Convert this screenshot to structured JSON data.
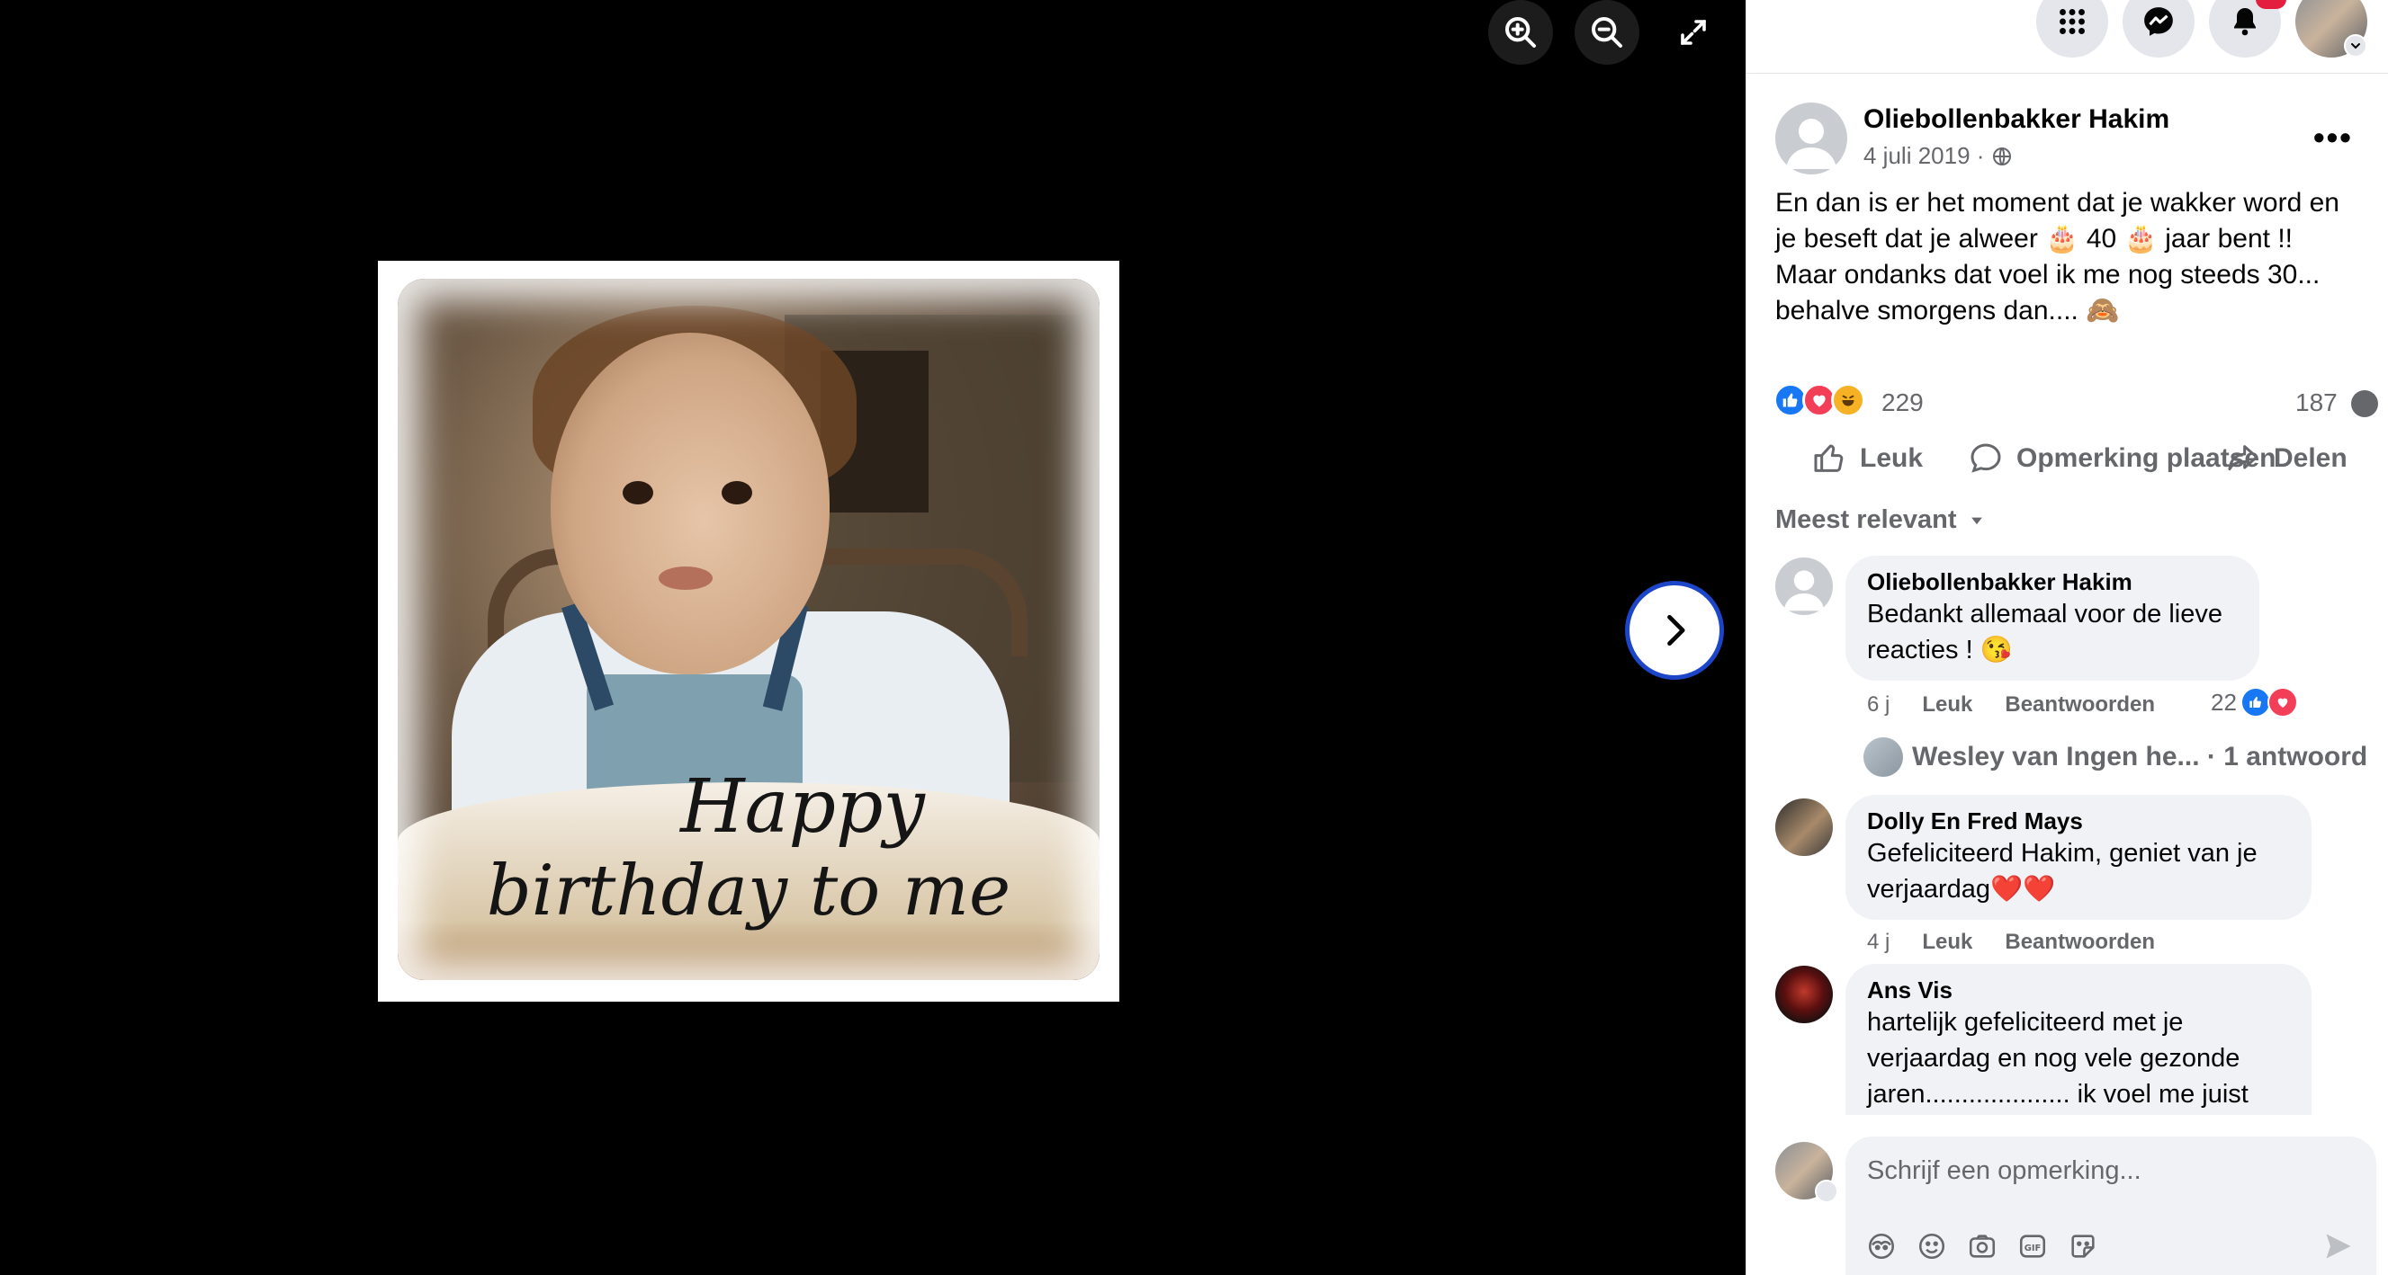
{
  "viewer": {
    "zoom_in_icon": "zoom-in-icon",
    "zoom_out_icon": "zoom-out-icon",
    "fullscreen_icon": "fullscreen-icon",
    "next_icon": "chevron-right-icon",
    "photo_caption_line1": "Happy",
    "photo_caption_line2": "birthday to me"
  },
  "topbar": {
    "menu_icon": "grid-menu-icon",
    "messenger_icon": "messenger-icon",
    "notifications_icon": "bell-icon",
    "account_icon": "chevron-down-icon"
  },
  "post": {
    "author": "Oliebollenbakker Hakim",
    "date": "4 juli 2019 ·",
    "privacy_icon": "globe-icon",
    "more_label": "•••",
    "text": "En dan is er het moment dat je wakker word en\nje beseft dat je alweer 🎂 40 🎂 jaar bent !!\nMaar ondanks dat voel ik me nog steeds 30...\nbehalve smorgens dan.... 🙈",
    "reaction_count": "229",
    "comment_count": "187",
    "actions": {
      "like": "Leuk",
      "comment": "Opmerking plaatsen",
      "share": "Delen"
    },
    "filter_label": "Meest relevant"
  },
  "comments": [
    {
      "author": "Oliebollenbakker Hakim",
      "text": "Bedankt allemaal voor de lieve\nreacties ! 😘",
      "time": "6 j",
      "like": "Leuk",
      "reply": "Beantwoorden",
      "likes": "22"
    },
    {
      "author": "Dolly En Fred Mays",
      "text": "Gefeliciteerd Hakim, geniet van je\nverjaardag❤️❤️",
      "time": "4 j",
      "like": "Leuk",
      "reply": "Beantwoorden"
    },
    {
      "author": "Ans Vis",
      "text": "hartelijk gefeliciteerd met je\nverjaardag en nog vele gezonde\njaren.................... ik voel me juist"
    }
  ],
  "reply_thread": "Wesley van Ingen he... · 1 antwoord",
  "compose": {
    "placeholder": "Schrijf een opmerking...",
    "tools": [
      "avatar-sticker-icon",
      "emoji-icon",
      "camera-icon",
      "gif-icon",
      "sticker-icon"
    ],
    "send_icon": "send-icon"
  },
  "colors": {
    "like_blue": "#1877f2",
    "love_red": "#f33e58",
    "haha_yellow": "#f7b125",
    "next_button_border": "#1c45c8"
  }
}
